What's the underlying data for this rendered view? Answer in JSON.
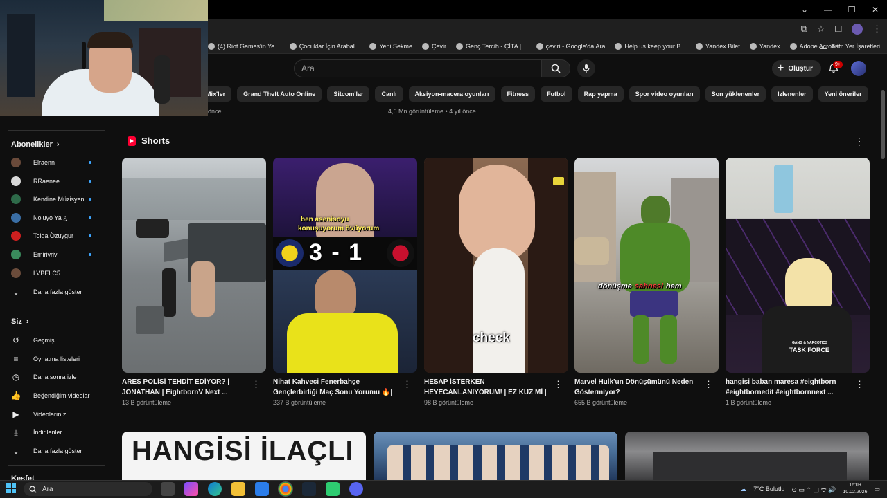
{
  "browser": {
    "bookmarks": [
      "(4) Riot Games'in Ye...",
      "Çocuklar İçin Arabal...",
      "Yeni Sekme",
      "Çevir",
      "Genç Tercih - ÇİTA |...",
      "çeviri - Google'da Ara",
      "Help us keep your B...",
      "Yandex.Bilet",
      "Yandex",
      "Adobe Acrobat"
    ],
    "all_bookmarks": "Tüm Yer İşaretleri"
  },
  "header": {
    "search_placeholder": "Ara",
    "create_label": "Oluştur",
    "notification_badge": "9+"
  },
  "chips": [
    "Mix'ler",
    "Grand Theft Auto Online",
    "Sitcom'lar",
    "Canlı",
    "Aksiyon-macera oyunları",
    "Fitness",
    "Futbol",
    "Rap yapma",
    "Spor video oyunları",
    "Son yüklenenler",
    "İzlenenler",
    "Yeni öneriler"
  ],
  "previous_row": {
    "left_meta": "önce",
    "mid_meta": "4,6 Mn görüntüleme • 4 yıl önce"
  },
  "sidebar": {
    "subscriptions_heading": "Abonelikler",
    "channels": [
      {
        "name": "Elraenn",
        "color": "#6a4a3a"
      },
      {
        "name": "RRaenee",
        "color": "#d8d8d8"
      },
      {
        "name": "Kendine Müzisyen",
        "color": "#2e6b4a"
      },
      {
        "name": "Noluyo Ya ¿",
        "color": "#3a6ea5"
      },
      {
        "name": "Tolga Özuygur",
        "color": "#cc1f1f"
      },
      {
        "name": "Emirivriv",
        "color": "#3a8a5c"
      },
      {
        "name": "LVBELC5",
        "color": "#6b4c3b"
      }
    ],
    "show_more_channels": "Daha fazla göster",
    "you_heading": "Siz",
    "you_items": [
      "Geçmiş",
      "Oynatma listeleri",
      "Daha sonra izle",
      "Beğendiğim videolar",
      "Videolarınız",
      "İndirilenler",
      "Daha fazla göster"
    ],
    "explore_heading": "Keşfet"
  },
  "shorts": {
    "heading": "Shorts",
    "items": [
      {
        "title": "ARES POLİSİ TEHDİT EDİYOR? | JONATHAN | EightbornV Next ...",
        "views": "13 B görüntüleme"
      },
      {
        "title": "Nihat Kahveci Fenerbahçe Gençlerbirliği Maç Sonu Yorumu 🔥| ...",
        "views": "237 B görüntüleme",
        "overlay_line1": "ben asenisoyu",
        "overlay_line2": "konuşuyorum övüyorum",
        "score": "3 - 1"
      },
      {
        "title": "HESAP İSTERKEN HEYECANLANIYORUM! | EZ KUZ Mİ | ...",
        "views": "98 B görüntüleme",
        "overlay": "check"
      },
      {
        "title": "Marvel Hulk'un Dönüşümünü Neden Göstermiyor?",
        "views": "655 B görüntüleme",
        "overlay_a": "dönüşme",
        "overlay_b": "sahnesi",
        "overlay_c": "hem"
      },
      {
        "title": "hangisi baban maresa  #eightborn #eightbornedit #eightbornnext ...",
        "views": "1 B görüntüleme",
        "vest_line1": "GANG & NARCOTICS",
        "vest_line2": "TASK FORCE"
      }
    ]
  },
  "bottom_row": {
    "thumb1_text": "HANGİSİ İLAÇLI"
  },
  "taskbar": {
    "search_label": "Ara",
    "weather": "7°C  Bulutlu",
    "time": "16:09",
    "date": "10.02.2026"
  }
}
